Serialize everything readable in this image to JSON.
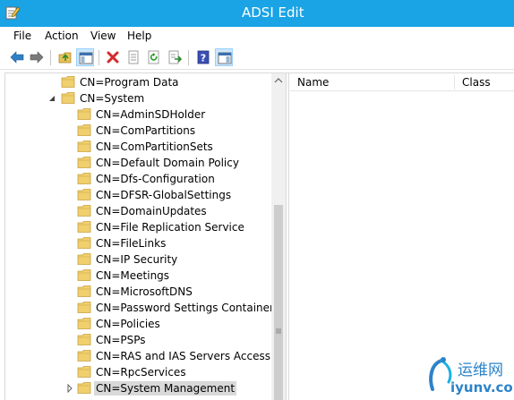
{
  "window": {
    "title": "ADSI Edit",
    "accent_color": "#1aa3e5"
  },
  "menu": [
    "File",
    "Action",
    "View",
    "Help"
  ],
  "toolbar": {
    "buttons": [
      "back-icon",
      "forward-icon",
      "up-folder-icon",
      "show-hide-tree-icon",
      "delete-icon",
      "properties-icon",
      "refresh-icon",
      "export-list-icon",
      "help-icon",
      "show-hide-action-pane-icon"
    ]
  },
  "tree": {
    "items": [
      {
        "label": "CN=Program Data",
        "level": 1,
        "expander": ""
      },
      {
        "label": "CN=System",
        "level": 1,
        "expander": "expanded"
      },
      {
        "label": "CN=AdminSDHolder",
        "level": 2,
        "expander": ""
      },
      {
        "label": "CN=ComPartitions",
        "level": 2,
        "expander": ""
      },
      {
        "label": "CN=ComPartitionSets",
        "level": 2,
        "expander": ""
      },
      {
        "label": "CN=Default Domain Policy",
        "level": 2,
        "expander": ""
      },
      {
        "label": "CN=Dfs-Configuration",
        "level": 2,
        "expander": ""
      },
      {
        "label": "CN=DFSR-GlobalSettings",
        "level": 2,
        "expander": ""
      },
      {
        "label": "CN=DomainUpdates",
        "level": 2,
        "expander": ""
      },
      {
        "label": "CN=File Replication Service",
        "level": 2,
        "expander": ""
      },
      {
        "label": "CN=FileLinks",
        "level": 2,
        "expander": ""
      },
      {
        "label": "CN=IP Security",
        "level": 2,
        "expander": ""
      },
      {
        "label": "CN=Meetings",
        "level": 2,
        "expander": ""
      },
      {
        "label": "CN=MicrosoftDNS",
        "level": 2,
        "expander": ""
      },
      {
        "label": "CN=Password Settings Container",
        "level": 2,
        "expander": ""
      },
      {
        "label": "CN=Policies",
        "level": 2,
        "expander": ""
      },
      {
        "label": "CN=PSPs",
        "level": 2,
        "expander": ""
      },
      {
        "label": "CN=RAS and IAS Servers Access Che",
        "level": 2,
        "expander": ""
      },
      {
        "label": "CN=RpcServices",
        "level": 2,
        "expander": ""
      },
      {
        "label": "CN=System Management",
        "level": 2,
        "expander": "collapsed",
        "selected": true
      }
    ]
  },
  "list": {
    "columns": [
      "Name",
      "Class"
    ]
  },
  "watermark": {
    "line1": "运维网",
    "line2": "iyunv.com"
  }
}
